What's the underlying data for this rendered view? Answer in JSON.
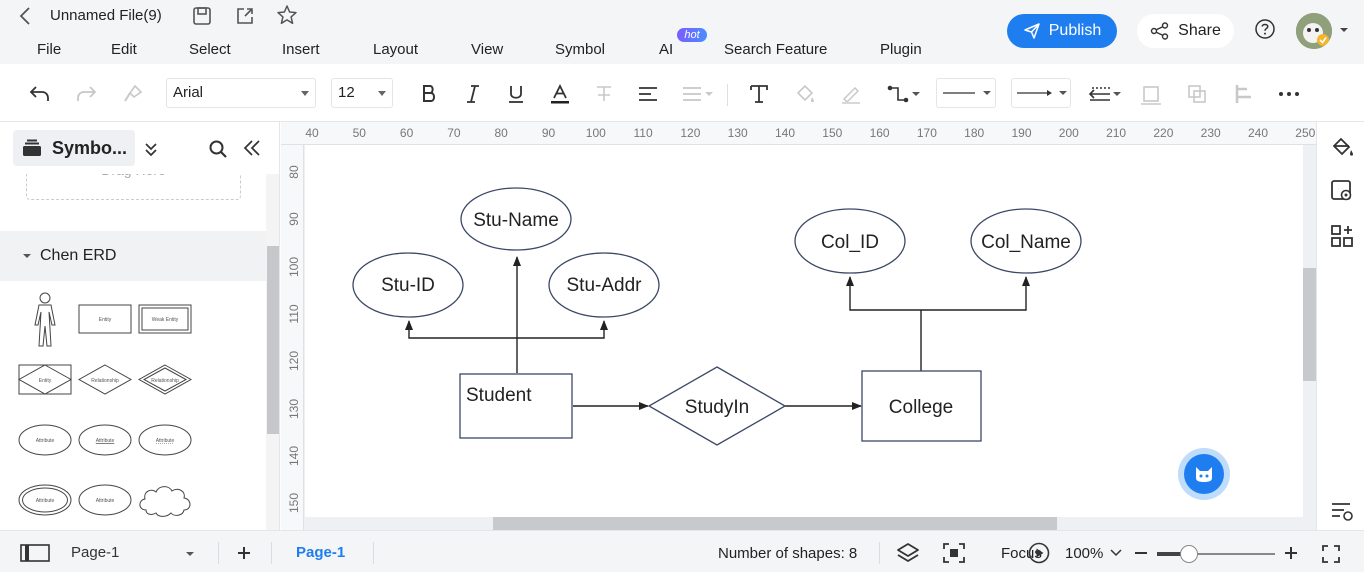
{
  "app": {
    "file_title": "Unnamed File(9)",
    "publish_label": "Publish",
    "share_label": "Share",
    "hot_badge": "hot"
  },
  "menu": {
    "items": [
      "File",
      "Edit",
      "Select",
      "Insert",
      "Layout",
      "View",
      "Symbol",
      "AI",
      "Search Feature",
      "Plugin"
    ]
  },
  "toolbar": {
    "font_family": "Arial",
    "font_size": "12"
  },
  "left_panel": {
    "library_tab": "Symbo...",
    "drag_hint": "Drag Here",
    "section_title": "Chen ERD",
    "symbols": [
      "Entity",
      "Weak Entity",
      "Entity",
      "Relationship",
      "Relationship",
      "Attribute",
      "Attribute",
      "Attribute",
      "Attribute",
      "Attribute"
    ]
  },
  "rulers": {
    "top": [
      "40",
      "50",
      "60",
      "70",
      "80",
      "90",
      "100",
      "110",
      "120",
      "130",
      "140",
      "150",
      "160",
      "170",
      "180",
      "190",
      "200",
      "210",
      "220",
      "230",
      "240",
      "250"
    ],
    "left": [
      "80",
      "90",
      "100",
      "110",
      "120",
      "130",
      "140",
      "150"
    ]
  },
  "diagram": {
    "entities": [
      "Student",
      "College"
    ],
    "relationship": "StudyIn",
    "student_attributes": [
      "Stu-Name",
      "Stu-ID",
      "Stu-Addr"
    ],
    "college_attributes": [
      "Col_ID",
      "Col_Name"
    ]
  },
  "status": {
    "page_select": "Page-1",
    "page_tab": "Page-1",
    "shape_count": "Number of shapes: 8",
    "focus_label": "Focus",
    "zoom": "100%",
    "zoom_fraction": 0.27
  },
  "colors": {
    "accent": "#1e7ef0",
    "canvas_bg": "#eef0f3",
    "shape_stroke": "#3b4766"
  }
}
